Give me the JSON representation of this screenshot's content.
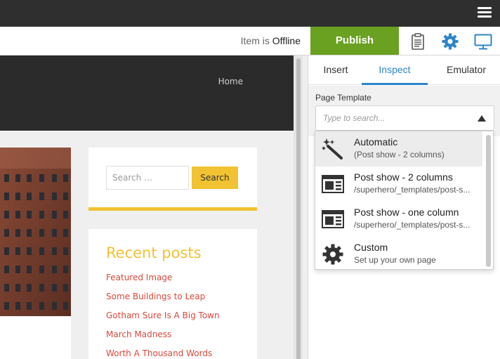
{
  "toolbar": {
    "status_prefix": "Item is",
    "status_value": "Offline",
    "publish_label": "Publish",
    "icons": [
      "clipboard-icon",
      "gear-icon",
      "desktop-icon"
    ],
    "accent": "#6aa121",
    "gear_color": "#2e86c9"
  },
  "site": {
    "nav_home": "Home",
    "search_placeholder": "Search …",
    "search_button": "Search",
    "recent_title": "Recent posts",
    "recent_posts": [
      "Featured Image",
      "Some Buildings to Leap",
      "Gotham Sure Is A Big Town",
      "March Madness",
      "Worth A Thousand Words"
    ]
  },
  "panel": {
    "tabs": [
      {
        "label": "Insert",
        "active": false
      },
      {
        "label": "Inspect",
        "active": true
      },
      {
        "label": "Emulator",
        "active": false
      }
    ],
    "field_label": "Page Template",
    "select_placeholder": "Type to search...",
    "options": [
      {
        "title": "Automatic",
        "subtitle": "(Post show - 2 columns)",
        "icon": "magic-wand-icon",
        "selected": true
      },
      {
        "title": "Post show - 2 columns",
        "subtitle": "/superhero/_templates/post-s...",
        "icon": "layout-icon",
        "selected": false
      },
      {
        "title": "Post show - one column",
        "subtitle": "/superhero/_templates/post-s...",
        "icon": "layout-icon",
        "selected": false
      },
      {
        "title": "Custom",
        "subtitle": "Set up your own page",
        "icon": "gear-icon",
        "selected": false
      }
    ]
  }
}
